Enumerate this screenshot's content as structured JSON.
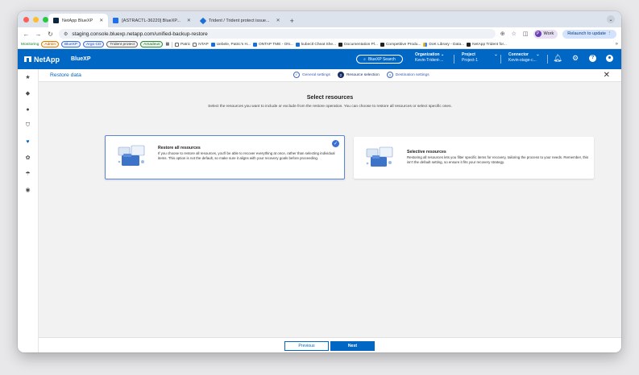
{
  "browser": {
    "tabs": [
      {
        "title": "NetApp BlueXP",
        "active": true
      },
      {
        "title": "[ASTRACTL-36220] BlueXP...",
        "active": false
      },
      {
        "title": "Trident / Trident protect issue...",
        "active": false
      }
    ],
    "new_tab": "+",
    "url": "staging.console.bluexp.netapp.com/unified-backup-restore",
    "profile_initial": "P",
    "profile_label": "Work",
    "relaunch_label": "Relaunch to update",
    "bookmarks": {
      "monitoring": "Monitoring",
      "chips": [
        "Admin",
        "BlueXP",
        "Argo CD",
        "Trident protect",
        "Amadeus"
      ],
      "items": [
        "Patric",
        "NTAP",
        "Uebele, Patric's H...",
        "ONTAP TME - ON...",
        "kubectl Cheat She...",
        "Documentation Pl...",
        "Competitive Produ...",
        "DoK Library - Data...",
        "NetApp Trident for..."
      ],
      "more": "»"
    }
  },
  "header": {
    "brand": "NetApp",
    "product": "BlueXP",
    "search_label": "BlueXP Search",
    "organization": {
      "label": "Organization",
      "value": "Kevin-Trident-..."
    },
    "project": {
      "label": "Project",
      "value": "Project-1"
    },
    "connector": {
      "label": "Connector",
      "value": "Kevin-stage-c..."
    },
    "colors": {
      "primary": "#0067c5"
    }
  },
  "page": {
    "title": "Restore data",
    "steps": [
      {
        "num": "✓",
        "label": "General settings",
        "state": "done"
      },
      {
        "num": "2",
        "label": "Resource selection",
        "state": "current"
      },
      {
        "num": "3",
        "label": "Destination settings",
        "state": "upcoming"
      }
    ],
    "heading": "Select resources",
    "subheading": "Select the resources you want to include or exclude from the restore operation. You can choose to restore all resources or select specific ones.",
    "options": {
      "restore_all": {
        "title": "Restore all resources",
        "description": "If you choose to restore all resources, you'll be able to recover everything at once, rather than selecting individual items. This option is not the default, so make sure it aligns with your recovery goals before proceeding.",
        "selected": true
      },
      "selective": {
        "title": "Selective resources",
        "description": "Restoring all resources lets you filter specific items for recovery, tailoring the process to your needs. Remember, this isn't the default setting, so ensure it fits your recovery strategy.",
        "selected": false
      }
    },
    "buttons": {
      "previous": "Previous",
      "next": "Next"
    }
  }
}
